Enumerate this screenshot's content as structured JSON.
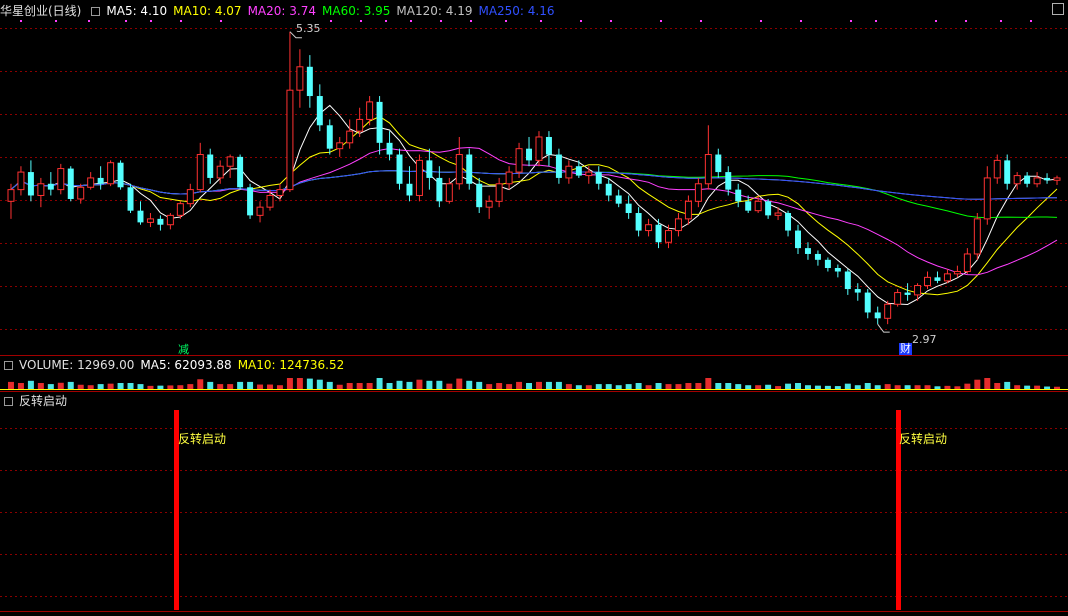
{
  "stock": {
    "title": "华星创业(日线)",
    "ma_labels": [
      {
        "text": "MA5: 4.10",
        "color": "#ffffff"
      },
      {
        "text": "MA10: 4.07",
        "color": "#ffff00"
      },
      {
        "text": "MA20: 3.74",
        "color": "#ff40ff"
      },
      {
        "text": "MA60: 3.95",
        "color": "#00ff00"
      },
      {
        "text": "MA120: 4.19",
        "color": "#c0c0c0"
      },
      {
        "text": "MA250: 4.16",
        "color": "#3050ff"
      }
    ]
  },
  "volume": {
    "title": "VOLUME: 12969.00",
    "ma_labels": [
      {
        "text": "MA5: 62093.88",
        "color": "#ffffff"
      },
      {
        "text": "MA10: 124736.52",
        "color": "#ffff00"
      }
    ]
  },
  "indicator": {
    "title": "反转启动",
    "signal_label": "反转启动"
  },
  "annotations": {
    "high_label": "5.35",
    "low_label": "2.97",
    "note_tag": "减",
    "finance_tag": "财"
  },
  "colors": {
    "up": "#ff3232",
    "down": "#54ffff",
    "signal": "#ff0000",
    "grid": "#8b0000"
  },
  "chart_data": [
    {
      "type": "candlestick",
      "title": "华星创业(日线)",
      "ylim": [
        2.8,
        5.45
      ],
      "grid": true,
      "candles": [
        {
          "o": 3.9,
          "h": 4.05,
          "l": 3.75,
          "c": 4.0
        },
        {
          "o": 4.0,
          "h": 4.2,
          "l": 3.95,
          "c": 4.15
        },
        {
          "o": 4.15,
          "h": 4.25,
          "l": 3.9,
          "c": 3.95
        },
        {
          "o": 3.95,
          "h": 4.1,
          "l": 3.85,
          "c": 4.05
        },
        {
          "o": 4.05,
          "h": 4.15,
          "l": 3.95,
          "c": 4.0
        },
        {
          "o": 4.0,
          "h": 4.22,
          "l": 3.96,
          "c": 4.18
        },
        {
          "o": 4.18,
          "h": 4.2,
          "l": 3.9,
          "c": 3.92
        },
        {
          "o": 3.92,
          "h": 4.05,
          "l": 3.88,
          "c": 4.02
        },
        {
          "o": 4.02,
          "h": 4.15,
          "l": 4.0,
          "c": 4.1
        },
        {
          "o": 4.1,
          "h": 4.2,
          "l": 4.0,
          "c": 4.05
        },
        {
          "o": 4.05,
          "h": 4.25,
          "l": 4.03,
          "c": 4.23
        },
        {
          "o": 4.23,
          "h": 4.25,
          "l": 4.0,
          "c": 4.02
        },
        {
          "o": 4.02,
          "h": 4.05,
          "l": 3.8,
          "c": 3.82
        },
        {
          "o": 3.82,
          "h": 3.9,
          "l": 3.7,
          "c": 3.72
        },
        {
          "o": 3.72,
          "h": 3.8,
          "l": 3.68,
          "c": 3.75
        },
        {
          "o": 3.75,
          "h": 3.78,
          "l": 3.65,
          "c": 3.7
        },
        {
          "o": 3.7,
          "h": 3.8,
          "l": 3.66,
          "c": 3.78
        },
        {
          "o": 3.78,
          "h": 3.9,
          "l": 3.75,
          "c": 3.88
        },
        {
          "o": 3.88,
          "h": 4.05,
          "l": 3.85,
          "c": 4.0
        },
        {
          "o": 4.0,
          "h": 4.4,
          "l": 3.98,
          "c": 4.3
        },
        {
          "o": 4.3,
          "h": 4.35,
          "l": 4.05,
          "c": 4.1
        },
        {
          "o": 4.1,
          "h": 4.25,
          "l": 4.05,
          "c": 4.2
        },
        {
          "o": 4.2,
          "h": 4.3,
          "l": 4.1,
          "c": 4.28
        },
        {
          "o": 4.28,
          "h": 4.3,
          "l": 4.0,
          "c": 4.02
        },
        {
          "o": 4.02,
          "h": 4.05,
          "l": 3.75,
          "c": 3.78
        },
        {
          "o": 3.78,
          "h": 3.9,
          "l": 3.72,
          "c": 3.85
        },
        {
          "o": 3.85,
          "h": 4.0,
          "l": 3.82,
          "c": 3.95
        },
        {
          "o": 3.95,
          "h": 4.05,
          "l": 3.9,
          "c": 4.0
        },
        {
          "o": 4.0,
          "h": 5.35,
          "l": 3.98,
          "c": 4.85
        },
        {
          "o": 4.85,
          "h": 5.2,
          "l": 4.7,
          "c": 5.05
        },
        {
          "o": 5.05,
          "h": 5.15,
          "l": 4.7,
          "c": 4.8
        },
        {
          "o": 4.8,
          "h": 4.9,
          "l": 4.5,
          "c": 4.55
        },
        {
          "o": 4.55,
          "h": 4.6,
          "l": 4.3,
          "c": 4.35
        },
        {
          "o": 4.35,
          "h": 4.45,
          "l": 4.28,
          "c": 4.4
        },
        {
          "o": 4.4,
          "h": 4.6,
          "l": 4.35,
          "c": 4.5
        },
        {
          "o": 4.5,
          "h": 4.7,
          "l": 4.45,
          "c": 4.6
        },
        {
          "o": 4.6,
          "h": 4.8,
          "l": 4.55,
          "c": 4.75
        },
        {
          "o": 4.75,
          "h": 4.8,
          "l": 4.3,
          "c": 4.4
        },
        {
          "o": 4.4,
          "h": 4.5,
          "l": 4.25,
          "c": 4.3
        },
        {
          "o": 4.3,
          "h": 4.35,
          "l": 4.0,
          "c": 4.05
        },
        {
          "o": 4.05,
          "h": 4.2,
          "l": 3.9,
          "c": 3.95
        },
        {
          "o": 3.95,
          "h": 4.3,
          "l": 3.9,
          "c": 4.25
        },
        {
          "o": 4.25,
          "h": 4.35,
          "l": 4.0,
          "c": 4.1
        },
        {
          "o": 4.1,
          "h": 4.2,
          "l": 3.85,
          "c": 3.9
        },
        {
          "o": 3.9,
          "h": 4.1,
          "l": 3.88,
          "c": 4.05
        },
        {
          "o": 4.05,
          "h": 4.45,
          "l": 4.0,
          "c": 4.3
        },
        {
          "o": 4.3,
          "h": 4.35,
          "l": 4.0,
          "c": 4.05
        },
        {
          "o": 4.05,
          "h": 4.1,
          "l": 3.8,
          "c": 3.85
        },
        {
          "o": 3.85,
          "h": 3.95,
          "l": 3.75,
          "c": 3.9
        },
        {
          "o": 3.9,
          "h": 4.1,
          "l": 3.85,
          "c": 4.05
        },
        {
          "o": 4.05,
          "h": 4.2,
          "l": 4.0,
          "c": 4.15
        },
        {
          "o": 4.15,
          "h": 4.4,
          "l": 4.1,
          "c": 4.35
        },
        {
          "o": 4.35,
          "h": 4.45,
          "l": 4.2,
          "c": 4.25
        },
        {
          "o": 4.25,
          "h": 4.5,
          "l": 4.2,
          "c": 4.45
        },
        {
          "o": 4.45,
          "h": 4.5,
          "l": 4.2,
          "c": 4.3
        },
        {
          "o": 4.3,
          "h": 4.35,
          "l": 4.05,
          "c": 4.1
        },
        {
          "o": 4.1,
          "h": 4.25,
          "l": 4.05,
          "c": 4.2
        },
        {
          "o": 4.2,
          "h": 4.25,
          "l": 4.1,
          "c": 4.12
        },
        {
          "o": 4.12,
          "h": 4.2,
          "l": 4.05,
          "c": 4.15
        },
        {
          "o": 4.15,
          "h": 4.2,
          "l": 4.0,
          "c": 4.05
        },
        {
          "o": 4.05,
          "h": 4.1,
          "l": 3.9,
          "c": 3.95
        },
        {
          "o": 3.95,
          "h": 4.0,
          "l": 3.85,
          "c": 3.88
        },
        {
          "o": 3.88,
          "h": 3.95,
          "l": 3.75,
          "c": 3.8
        },
        {
          "o": 3.8,
          "h": 3.85,
          "l": 3.6,
          "c": 3.65
        },
        {
          "o": 3.65,
          "h": 3.75,
          "l": 3.6,
          "c": 3.7
        },
        {
          "o": 3.7,
          "h": 3.75,
          "l": 3.5,
          "c": 3.55
        },
        {
          "o": 3.55,
          "h": 3.7,
          "l": 3.5,
          "c": 3.65
        },
        {
          "o": 3.65,
          "h": 3.8,
          "l": 3.6,
          "c": 3.75
        },
        {
          "o": 3.75,
          "h": 3.95,
          "l": 3.7,
          "c": 3.9
        },
        {
          "o": 3.9,
          "h": 4.1,
          "l": 3.85,
          "c": 4.05
        },
        {
          "o": 4.05,
          "h": 4.55,
          "l": 4.0,
          "c": 4.3
        },
        {
          "o": 4.3,
          "h": 4.35,
          "l": 4.1,
          "c": 4.15
        },
        {
          "o": 4.15,
          "h": 4.2,
          "l": 3.95,
          "c": 4.0
        },
        {
          "o": 4.0,
          "h": 4.05,
          "l": 3.85,
          "c": 3.9
        },
        {
          "o": 3.9,
          "h": 3.95,
          "l": 3.8,
          "c": 3.82
        },
        {
          "o": 3.82,
          "h": 3.95,
          "l": 3.8,
          "c": 3.9
        },
        {
          "o": 3.9,
          "h": 3.92,
          "l": 3.75,
          "c": 3.78
        },
        {
          "o": 3.78,
          "h": 3.85,
          "l": 3.74,
          "c": 3.8
        },
        {
          "o": 3.8,
          "h": 3.82,
          "l": 3.6,
          "c": 3.65
        },
        {
          "o": 3.65,
          "h": 3.7,
          "l": 3.45,
          "c": 3.5
        },
        {
          "o": 3.5,
          "h": 3.55,
          "l": 3.4,
          "c": 3.45
        },
        {
          "o": 3.45,
          "h": 3.48,
          "l": 3.35,
          "c": 3.4
        },
        {
          "o": 3.4,
          "h": 3.42,
          "l": 3.3,
          "c": 3.33
        },
        {
          "o": 3.33,
          "h": 3.36,
          "l": 3.25,
          "c": 3.3
        },
        {
          "o": 3.3,
          "h": 3.32,
          "l": 3.1,
          "c": 3.15
        },
        {
          "o": 3.15,
          "h": 3.2,
          "l": 3.05,
          "c": 3.12
        },
        {
          "o": 3.12,
          "h": 3.15,
          "l": 2.9,
          "c": 2.95
        },
        {
          "o": 2.95,
          "h": 3.0,
          "l": 2.85,
          "c": 2.9
        },
        {
          "o": 2.9,
          "h": 3.05,
          "l": 2.85,
          "c": 3.02
        },
        {
          "o": 3.02,
          "h": 3.15,
          "l": 3.0,
          "c": 3.12
        },
        {
          "o": 3.12,
          "h": 3.2,
          "l": 3.05,
          "c": 3.1
        },
        {
          "o": 3.1,
          "h": 3.2,
          "l": 3.05,
          "c": 3.18
        },
        {
          "o": 3.18,
          "h": 3.3,
          "l": 3.15,
          "c": 3.25
        },
        {
          "o": 3.25,
          "h": 3.3,
          "l": 3.2,
          "c": 3.22
        },
        {
          "o": 3.22,
          "h": 3.32,
          "l": 3.2,
          "c": 3.28
        },
        {
          "o": 3.28,
          "h": 3.35,
          "l": 3.25,
          "c": 3.3
        },
        {
          "o": 3.3,
          "h": 3.5,
          "l": 3.28,
          "c": 3.45
        },
        {
          "o": 3.45,
          "h": 3.8,
          "l": 3.4,
          "c": 3.75
        },
        {
          "o": 3.75,
          "h": 4.2,
          "l": 3.7,
          "c": 4.1
        },
        {
          "o": 4.1,
          "h": 4.3,
          "l": 4.05,
          "c": 4.25
        },
        {
          "o": 4.25,
          "h": 4.3,
          "l": 4.0,
          "c": 4.05
        },
        {
          "o": 4.05,
          "h": 4.15,
          "l": 4.0,
          "c": 4.12
        },
        {
          "o": 4.12,
          "h": 4.15,
          "l": 4.02,
          "c": 4.05
        },
        {
          "o": 4.05,
          "h": 4.15,
          "l": 4.02,
          "c": 4.1
        },
        {
          "o": 4.1,
          "h": 4.14,
          "l": 4.05,
          "c": 4.08
        },
        {
          "o": 4.08,
          "h": 4.12,
          "l": 4.04,
          "c": 4.1
        }
      ]
    },
    {
      "type": "bar",
      "title": "VOLUME: 12969.00",
      "ylim": [
        0,
        1
      ]
    },
    {
      "type": "bar",
      "title": "反转启动",
      "signals": [
        {
          "index": 28
        },
        {
          "index": 143
        }
      ]
    }
  ]
}
